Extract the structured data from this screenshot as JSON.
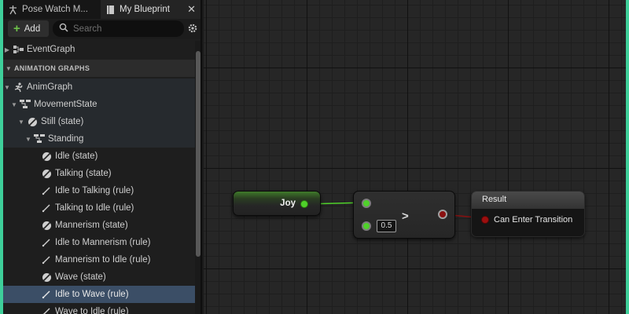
{
  "tabs": [
    {
      "label": "Pose Watch M...",
      "icon": "pose-watch-icon"
    },
    {
      "label": "My Blueprint",
      "icon": "blueprint-book-icon",
      "close": "✕"
    }
  ],
  "toolbar": {
    "add_label": "Add",
    "search_placeholder": "Search"
  },
  "tree": {
    "event_graph": "EventGraph",
    "section_header": "ANIMATION GRAPHS",
    "items": [
      {
        "label": "AnimGraph",
        "icon": "anim-graph-icon"
      },
      {
        "label": "MovementState",
        "icon": "state-machine-icon"
      },
      {
        "label": "Still (state)",
        "icon": "state-icon"
      },
      {
        "label": "Standing",
        "icon": "state-machine-icon"
      },
      {
        "label": "Idle (state)",
        "icon": "state-icon"
      },
      {
        "label": "Talking (state)",
        "icon": "state-icon"
      },
      {
        "label": "Idle to Talking (rule)",
        "icon": "rule-icon"
      },
      {
        "label": "Talking to Idle (rule)",
        "icon": "rule-icon"
      },
      {
        "label": "Mannerism (state)",
        "icon": "state-icon"
      },
      {
        "label": "Idle to Mannerism (rule)",
        "icon": "rule-icon"
      },
      {
        "label": "Mannerism to Idle (rule)",
        "icon": "rule-icon"
      },
      {
        "label": "Wave (state)",
        "icon": "state-icon"
      },
      {
        "label": "Idle to Wave (rule)",
        "icon": "rule-icon",
        "selected": true
      },
      {
        "label": "Wave to Idle (rule)",
        "icon": "rule-icon"
      }
    ]
  },
  "graph": {
    "joy_node": {
      "label": "Joy"
    },
    "compare_node": {
      "operator": ">",
      "value": "0.5"
    },
    "result_node": {
      "title": "Result",
      "pin_label": "Can Enter Transition"
    }
  },
  "colors": {
    "bool_pin": "#9c0f0f",
    "float_pin": "#4fd12a",
    "selection": "#3b4e66",
    "accent_border": "#3ecf9a"
  }
}
